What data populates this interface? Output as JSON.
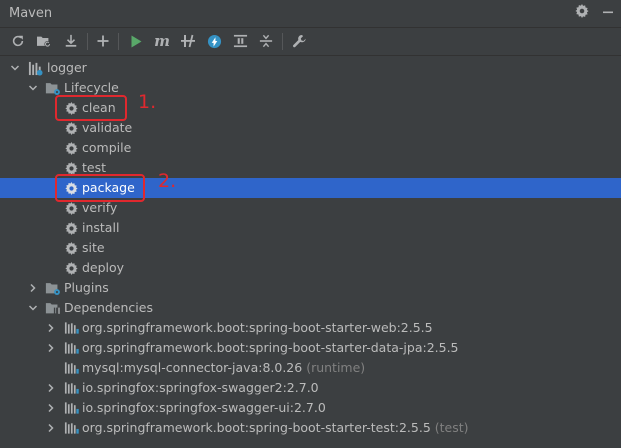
{
  "panel": {
    "title": "Maven",
    "icons": [
      "settings-icon",
      "minimize-icon"
    ]
  },
  "toolbar": {
    "items": [
      {
        "name": "reload-all-projects-button",
        "icon": "reload-icon"
      },
      {
        "name": "generate-sources-button",
        "icon": "folder-refresh-icon"
      },
      {
        "name": "download-sources-button",
        "icon": "download-icon"
      },
      {
        "name": "add-maven-project-button",
        "icon": "plus-icon"
      },
      {
        "name": "run-maven-build-button",
        "icon": "run-icon"
      },
      {
        "name": "execute-maven-goal-button",
        "icon": "maven-m-icon"
      },
      {
        "name": "toggle-offline-mode-button",
        "icon": "offline-icon"
      },
      {
        "name": "skip-tests-button",
        "icon": "skip-tests-icon"
      },
      {
        "name": "show-dependencies-button",
        "icon": "dependencies-icon"
      },
      {
        "name": "collapse-all-button",
        "icon": "collapse-icon"
      },
      {
        "name": "maven-settings-button",
        "icon": "wrench-icon"
      }
    ]
  },
  "tree": {
    "project": "logger",
    "lifecycle": {
      "label": "Lifecycle",
      "goals": [
        "clean",
        "validate",
        "compile",
        "test",
        "package",
        "verify",
        "install",
        "site",
        "deploy"
      ],
      "selected": "package"
    },
    "plugins": {
      "label": "Plugins"
    },
    "dependencies": {
      "label": "Dependencies",
      "items": [
        {
          "label": "org.springframework.boot:spring-boot-starter-web:2.5.5",
          "suffix": "",
          "expandable": true
        },
        {
          "label": "org.springframework.boot:spring-boot-starter-data-jpa:2.5.5",
          "suffix": "",
          "expandable": true
        },
        {
          "label": "mysql:mysql-connector-java:8.0.26",
          "suffix": "(runtime)",
          "expandable": false
        },
        {
          "label": "io.springfox:springfox-swagger2:2.7.0",
          "suffix": "",
          "expandable": true
        },
        {
          "label": "io.springfox:springfox-swagger-ui:2.7.0",
          "suffix": "",
          "expandable": true
        },
        {
          "label": "org.springframework.boot:spring-boot-starter-test:2.5.5",
          "suffix": "(test)",
          "expandable": true
        }
      ]
    }
  },
  "annotations": {
    "one": "1.",
    "two": "2."
  },
  "colors": {
    "selection": "#2f65ca",
    "annotation": "#e0282e",
    "run": "#59a869",
    "background": "#3c3f41"
  }
}
